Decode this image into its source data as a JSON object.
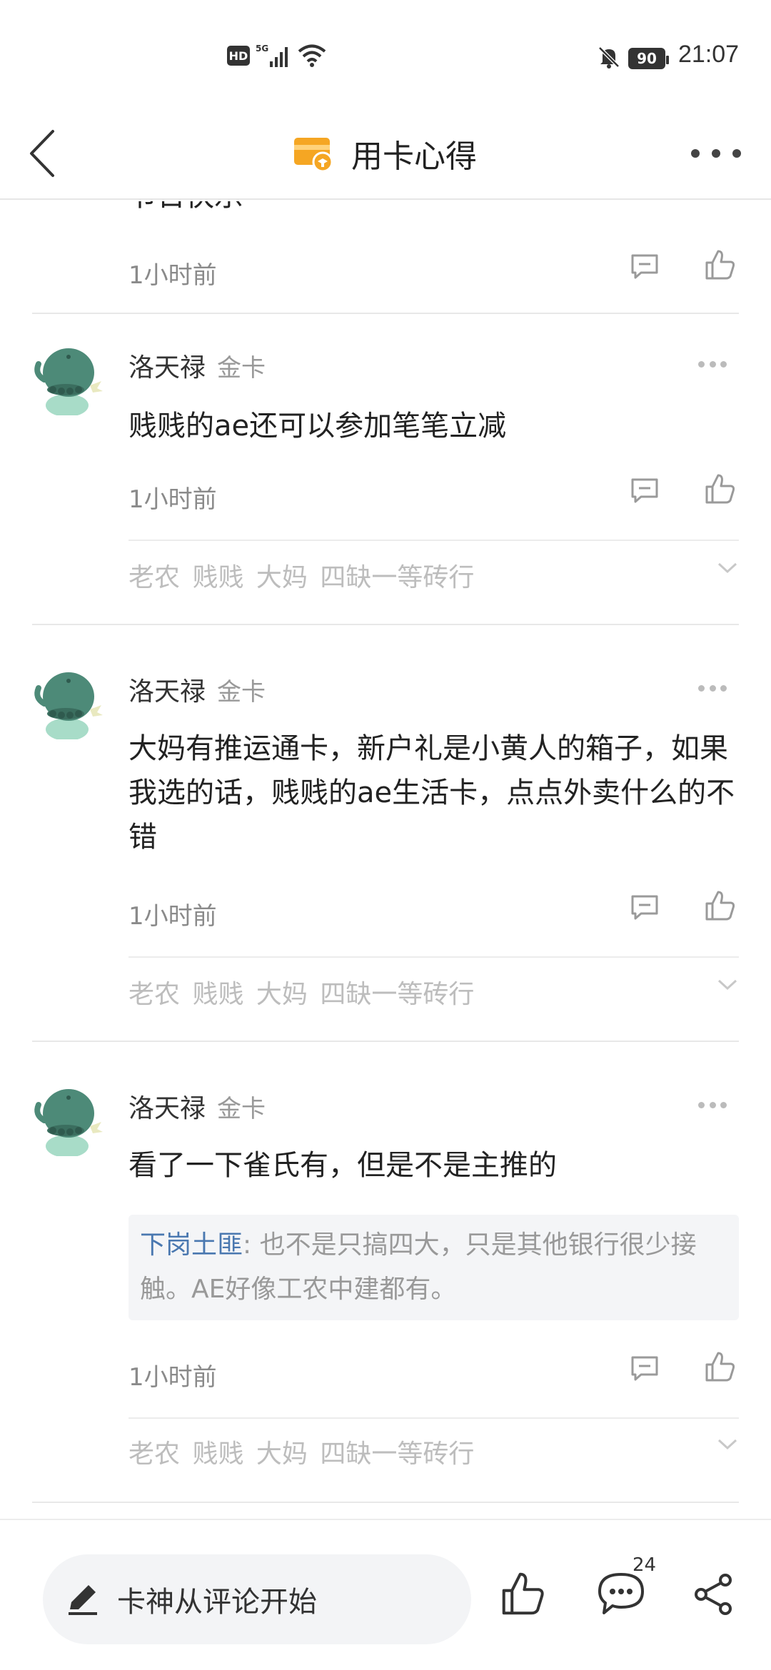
{
  "status_bar": {
    "hd": "HD",
    "network": "5G",
    "battery": "90",
    "time": "21:07"
  },
  "header": {
    "title": "用卡心得",
    "icon": "card-icon",
    "accent_color": "#f5a623"
  },
  "previous_comment": {
    "partial_text": "节日快乐",
    "time": "1小时前"
  },
  "comments": [
    {
      "user": "洛天禄",
      "badge": "金卡",
      "text": "贱贱的ae还可以参加笔笔立减",
      "time": "1小时前",
      "tags": "老农 贱贱 大妈  四缺一等砖行"
    },
    {
      "user": "洛天禄",
      "badge": "金卡",
      "text": "大妈有推运通卡，新户礼是小黄人的箱子，如果我选的话，贱贱的ae生活卡，点点外卖什么的不错",
      "time": "1小时前",
      "tags": "老农 贱贱 大妈  四缺一等砖行"
    },
    {
      "user": "洛天禄",
      "badge": "金卡",
      "text": "看了一下雀氏有，但是不是主推的",
      "quote_user": "下岗土匪",
      "quote_text": ": 也不是只搞四大，只是其他银行很少接触。AE好像工农中建都有。",
      "time": "1小时前",
      "tags": "老农 贱贱 大妈  四缺一等砖行"
    }
  ],
  "bottom_bar": {
    "input_placeholder": "卡神从评论开始",
    "comment_count": "24"
  }
}
